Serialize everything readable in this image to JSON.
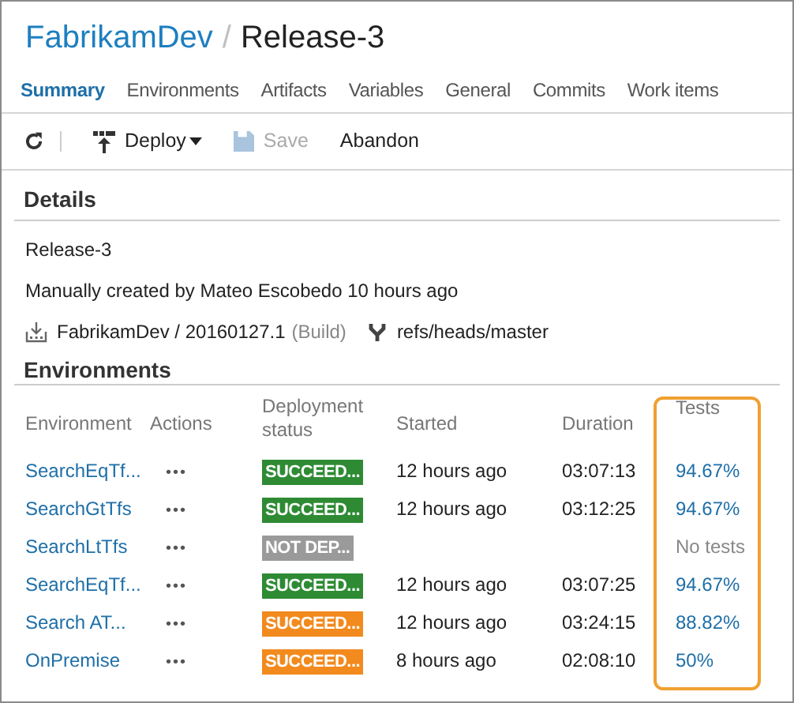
{
  "breadcrumb": {
    "project": "FabrikamDev",
    "separator": "/",
    "release": "Release-3"
  },
  "tabs": [
    {
      "label": "Summary",
      "selected": true
    },
    {
      "label": "Environments",
      "selected": false
    },
    {
      "label": "Artifacts",
      "selected": false
    },
    {
      "label": "Variables",
      "selected": false
    },
    {
      "label": "General",
      "selected": false
    },
    {
      "label": "Commits",
      "selected": false
    },
    {
      "label": "Work items",
      "selected": false
    }
  ],
  "toolbar": [
    {
      "kind": "refresh"
    },
    {
      "kind": "deploy",
      "label": "Deploy",
      "disabled": false
    },
    {
      "kind": "save",
      "label": "Save",
      "disabled": true
    },
    {
      "kind": "plain",
      "label": "Abandon",
      "disabled": false
    }
  ],
  "details": {
    "title": "Details",
    "name": "Release-3",
    "created": "Manually created by Mateo Escobedo 10 hours ago",
    "artifact": "FabrikamDev / 20160127.1",
    "artifact_type": "(Build)",
    "branch": "refs/heads/master"
  },
  "environments": {
    "title": "Environments",
    "columns": [
      "Environment",
      "Actions",
      "Deployment status",
      "Started",
      "Duration",
      "Tests"
    ],
    "rows": [
      {
        "name": "SearchEqTf...",
        "actions": "•••",
        "status": "SUCCEED...",
        "color": "#2e8b34",
        "started": "12 hours ago",
        "duration": "03:07:13",
        "tests": "94.67%",
        "kind": "link"
      },
      {
        "name": "SearchGtTfs",
        "actions": "•••",
        "status": "SUCCEED...",
        "color": "#2e8b34",
        "started": "12 hours ago",
        "duration": "03:12:25",
        "tests": "94.67%",
        "kind": "link"
      },
      {
        "name": "SearchLtTfs",
        "actions": "•••",
        "status": "NOT DEP...",
        "color": "#9a9a9a",
        "tests": "No tests",
        "kind": "none"
      },
      {
        "name": "SearchEqTf...",
        "actions": "•••",
        "status": "SUCCEED...",
        "color": "#2e8b34",
        "started": "12 hours ago",
        "duration": "03:07:25",
        "tests": "94.67%",
        "kind": "link"
      },
      {
        "name": "Search AT...",
        "actions": "•••",
        "status": "SUCCEED...",
        "color": "#f28a1e",
        "started": "12 hours ago",
        "duration": "03:24:15",
        "tests": "88.82%",
        "kind": "link"
      },
      {
        "name": "OnPremise",
        "actions": "•••",
        "status": "SUCCEED...",
        "color": "#f28a1e",
        "started": "8 hours ago",
        "duration": "02:08:10",
        "tests": "50%",
        "kind": "link"
      }
    ]
  }
}
